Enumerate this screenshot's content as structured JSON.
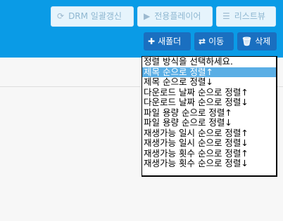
{
  "toolbar": {
    "drm_update_label": "DRM 일괄갱신",
    "player_label": "전용플레이어",
    "list_view_label": "리스트뷰",
    "new_folder_label": "새폴더",
    "move_label": "이동",
    "delete_label": "삭제"
  },
  "sort_dropdown": {
    "options": [
      "정렬 방식을 선택하세요.",
      "제목 순으로 정렬↑",
      "제목 순으로 정렬↓",
      "다운로드 날짜 순으로 정렬↑",
      "다운로드 날짜 순으로 정렬↓",
      "파일 용량 순으로 정렬↑",
      "파일 용량 순으로 정렬↓",
      "재생가능 일시 순으로 정렬↑",
      "재생가능 일시 순으로 정렬↓",
      "재생가능 횟수 순으로 정렬↑",
      "재생가능 횟수 순으로 정렬↓"
    ],
    "highlighted_index": 1
  },
  "colors": {
    "header_bg": "#0a9be6",
    "action_button_bg": "#1a6fc0",
    "highlight": "#5aaee5"
  }
}
